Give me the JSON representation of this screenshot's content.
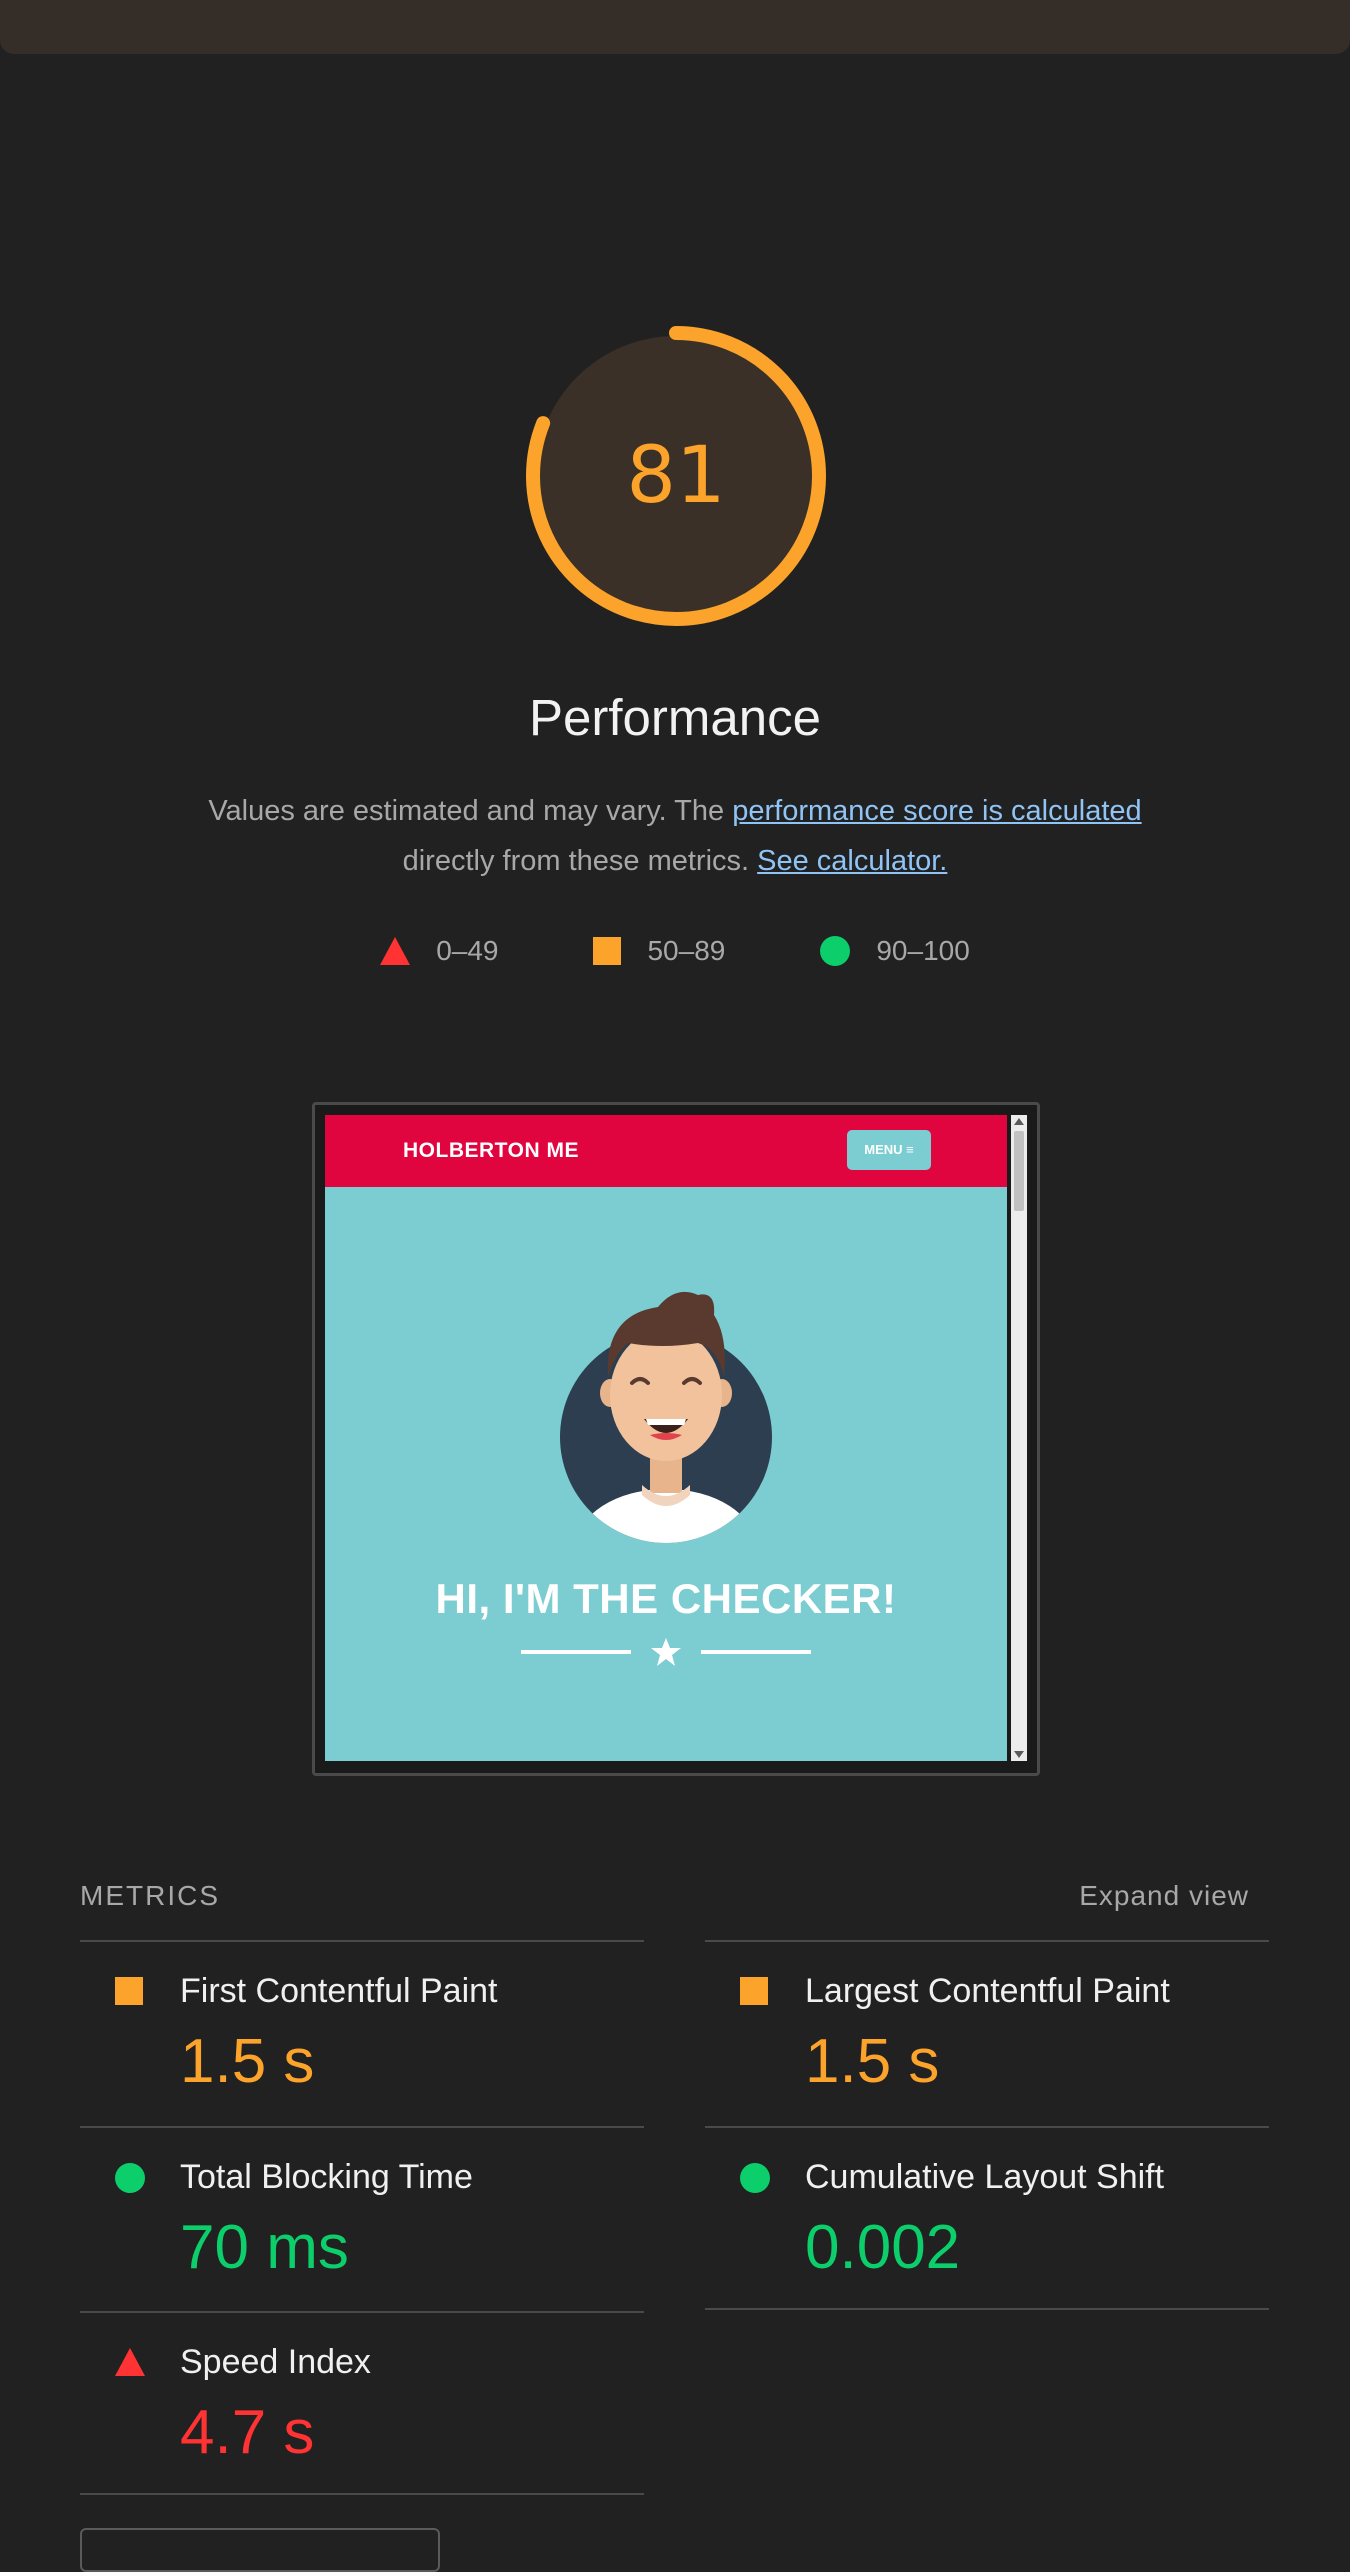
{
  "gauge": {
    "score": "81",
    "fraction": 0.81,
    "title": "Performance"
  },
  "description": {
    "text_before": "Values are estimated and may vary. The ",
    "link_score": "performance score is calculated",
    "text_middle": "directly from these metrics. ",
    "link_calculator": "See calculator."
  },
  "legend": [
    {
      "range": "0–49",
      "shape": "triangle",
      "color": "#ff3333"
    },
    {
      "range": "50–89",
      "shape": "square",
      "color": "#fba32b"
    },
    {
      "range": "90–100",
      "shape": "circle",
      "color": "#0cce6b"
    }
  ],
  "screenshot": {
    "brand": "HOLBERTON ME",
    "menu_label": "MENU ≡",
    "heading": "HI, I'M THE CHECKER!"
  },
  "metrics": {
    "title": "METRICS",
    "expand_label": "Expand view",
    "items": [
      {
        "label": "First Contentful Paint",
        "value": "1.5 s",
        "status": "average"
      },
      {
        "label": "Largest Contentful Paint",
        "value": "1.5 s",
        "status": "average"
      },
      {
        "label": "Total Blocking Time",
        "value": "70 ms",
        "status": "pass"
      },
      {
        "label": "Cumulative Layout Shift",
        "value": "0.002",
        "status": "pass"
      },
      {
        "label": "Speed Index",
        "value": "4.7 s",
        "status": "fail"
      }
    ]
  },
  "colors": {
    "average": "#fba32b",
    "pass": "#0cce6b",
    "fail": "#ff3333",
    "background": "#212121"
  }
}
